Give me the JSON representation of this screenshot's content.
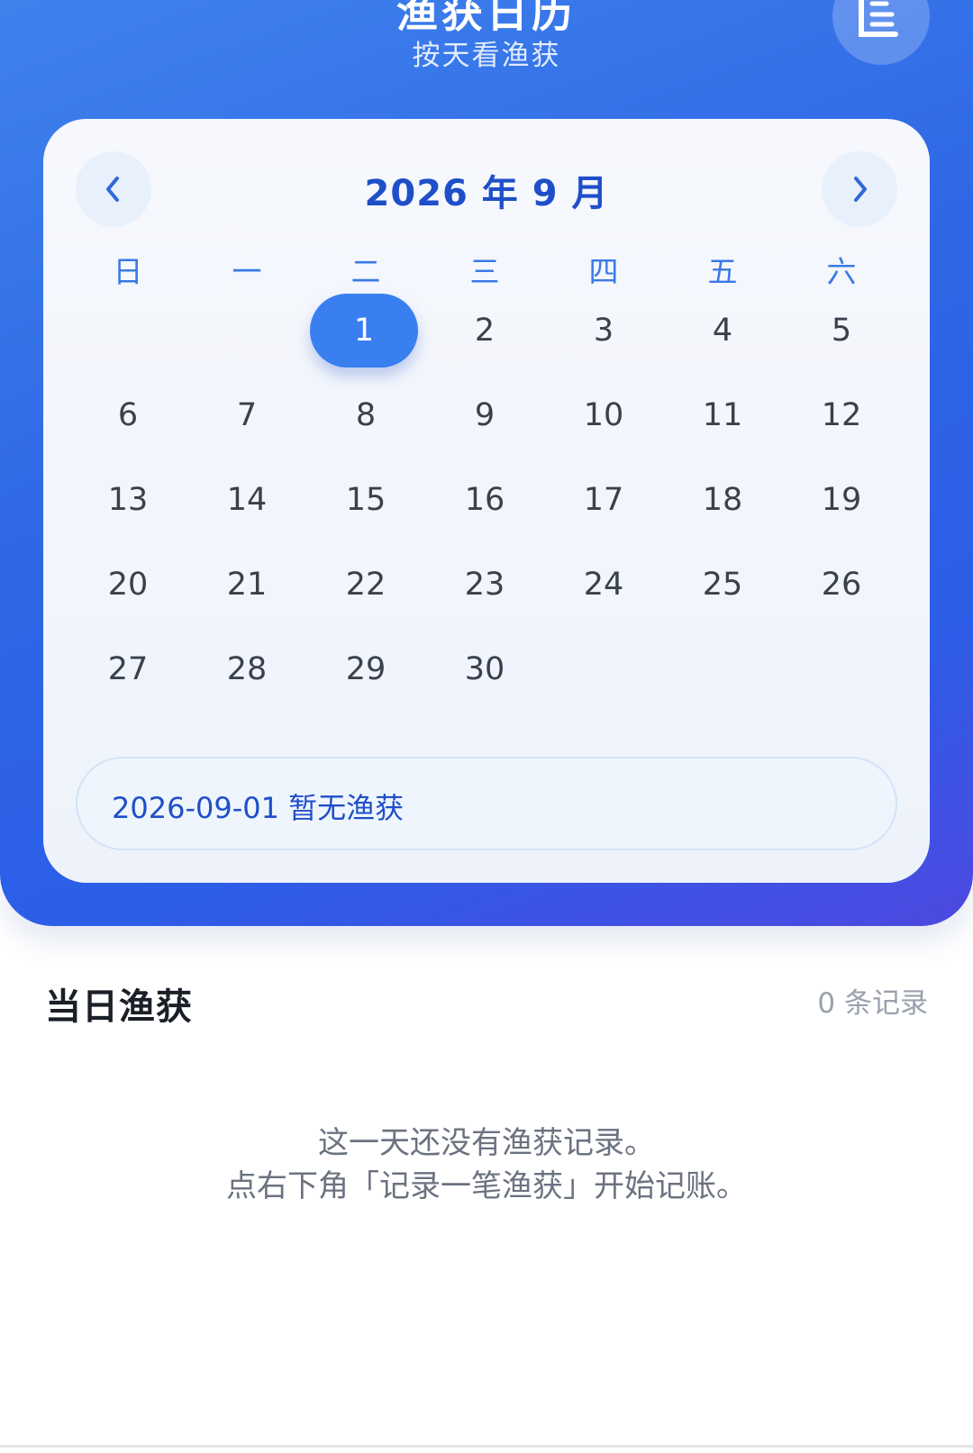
{
  "header": {
    "title": "渔获日历",
    "subtitle": "按天看渔获",
    "action_icon": "notepad-icon"
  },
  "calendar": {
    "month_title": "2026 年 9 月",
    "prev_icon": "chevron-left-icon",
    "next_icon": "chevron-right-icon",
    "weekdays": [
      "日",
      "一",
      "二",
      "三",
      "四",
      "五",
      "六"
    ],
    "weeks": [
      [
        "",
        "",
        "1",
        "2",
        "3",
        "4",
        "5"
      ],
      [
        "6",
        "7",
        "8",
        "9",
        "10",
        "11",
        "12"
      ],
      [
        "13",
        "14",
        "15",
        "16",
        "17",
        "18",
        "19"
      ],
      [
        "20",
        "21",
        "22",
        "23",
        "24",
        "25",
        "26"
      ],
      [
        "27",
        "28",
        "29",
        "30",
        "",
        "",
        ""
      ]
    ],
    "selected_day": "1",
    "selected_info": "2026-09-01 暂无渔获"
  },
  "daily": {
    "title": "当日渔获",
    "count_text": "0 条记录",
    "empty_line1": "这一天还没有渔获记录。",
    "empty_line2": "点右下角「记录一笔渔获」开始记账。"
  },
  "colors": {
    "accent": "#3a7ff0",
    "header_gradient_start": "#3f82ec",
    "header_gradient_end": "#4d48e0"
  }
}
